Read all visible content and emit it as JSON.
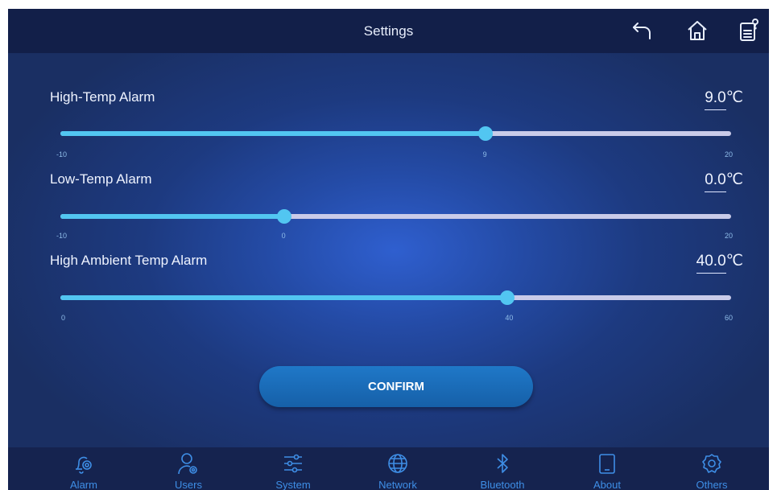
{
  "header": {
    "title": "Settings",
    "icons": [
      "back-icon",
      "home-icon",
      "manual-icon"
    ]
  },
  "settings": [
    {
      "label": "High-Temp Alarm",
      "value": "9.0",
      "unit": "℃",
      "min": -10,
      "max": 20,
      "current": 9,
      "min_label": "-10",
      "max_label": "20",
      "current_label": "9"
    },
    {
      "label": "Low-Temp Alarm",
      "value": "0.0",
      "unit": "℃",
      "min": -10,
      "max": 20,
      "current": 0,
      "min_label": "-10",
      "max_label": "20",
      "current_label": "0"
    },
    {
      "label": "High Ambient Temp Alarm",
      "value": "40.0",
      "unit": "℃",
      "min": 0,
      "max": 60,
      "current": 40,
      "min_label": "0",
      "max_label": "60",
      "current_label": "40"
    }
  ],
  "confirm_label": "CONFIRM",
  "nav": [
    {
      "label": "Alarm",
      "icon": "alarm-bell-gear-icon",
      "active": true
    },
    {
      "label": "Users",
      "icon": "user-gear-icon",
      "active": false
    },
    {
      "label": "System",
      "icon": "sliders-icon",
      "active": false
    },
    {
      "label": "Network",
      "icon": "globe-icon",
      "active": false
    },
    {
      "label": "Bluetooth",
      "icon": "bluetooth-icon",
      "active": false
    },
    {
      "label": "About",
      "icon": "tablet-icon",
      "active": false
    },
    {
      "label": "Others",
      "icon": "gear-icon",
      "active": false
    }
  ],
  "colors": {
    "accent": "#52c6f1",
    "track": "#c9cbe9",
    "topbar": "#121f49",
    "bottombar": "#15234f",
    "nav_inactive": "#3e8ee6"
  }
}
